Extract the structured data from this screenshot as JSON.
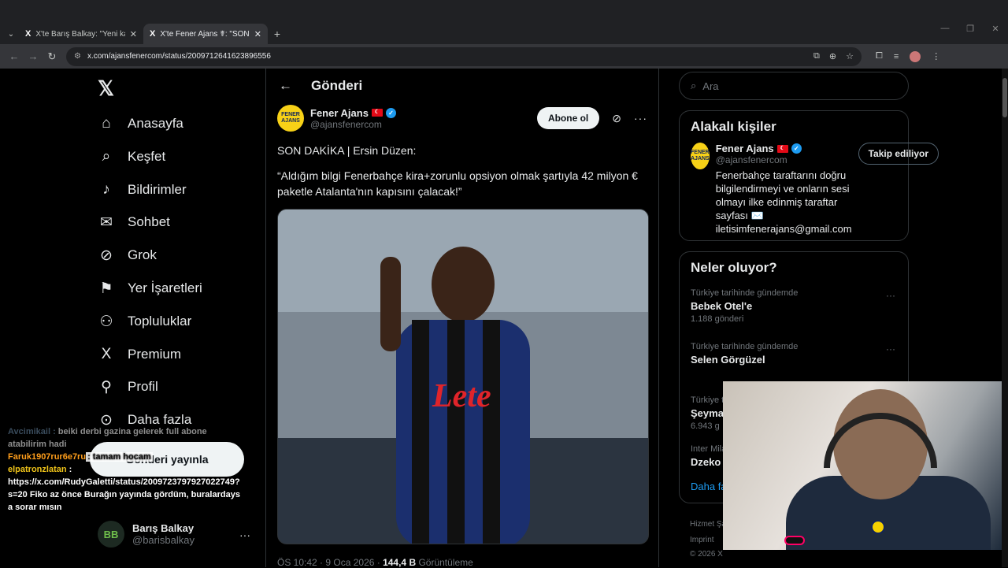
{
  "browser": {
    "tabs": [
      {
        "title": "X'te Barış Balkay: \"Yeni kamera",
        "favicon": "X"
      },
      {
        "title": "X'te Fener Ajans ☤: \"SON DAKİ",
        "favicon": "X"
      }
    ],
    "url": "x.com/ajansfenercom/status/2009712641623896556"
  },
  "nav": {
    "items": [
      {
        "label": "Anasayfa",
        "icon": "home-icon",
        "glyph": "⌂"
      },
      {
        "label": "Keşfet",
        "icon": "search-icon",
        "glyph": "⌕"
      },
      {
        "label": "Bildirimler",
        "icon": "bell-icon",
        "glyph": "🔔"
      },
      {
        "label": "Sohbet",
        "icon": "mail-icon",
        "glyph": "✉"
      },
      {
        "label": "Grok",
        "icon": "grok-icon",
        "glyph": "⊘"
      },
      {
        "label": "Yer İşaretleri",
        "icon": "bookmark-icon",
        "glyph": "⚑"
      },
      {
        "label": "Topluluklar",
        "icon": "communities-icon",
        "glyph": "⚇"
      },
      {
        "label": "Premium",
        "icon": "x-premium-icon",
        "glyph": "𝕏"
      },
      {
        "label": "Profil",
        "icon": "profile-icon",
        "glyph": "⚲"
      },
      {
        "label": "Daha fazla",
        "icon": "more-circle-icon",
        "glyph": "⊙"
      }
    ],
    "post_button": "Gönderi yayınla",
    "account": {
      "name": "Barış Balkay",
      "handle": "@barisbalkay",
      "avatar": "BB"
    }
  },
  "post": {
    "header": "Gönderi",
    "author": "Fener Ajans",
    "handle": "@ajansfenercom",
    "avatar_text": "FENER AJANS",
    "subscribe": "Abone ol",
    "line1": "SON DAKİKA | Ersin Düzen:",
    "line2": "“Aldığım bilgi Fenerbahçe kira+zorunlu opsiyon olmak şartıyla 42 milyon € paketle Atalanta'nın kapısını çalacak!”",
    "meta_time": "ÖS 10:42 · 9 Oca 2026 · ",
    "meta_views": "144,4 B",
    "meta_views_label": " Görüntüleme"
  },
  "right": {
    "search_placeholder": "Ara",
    "related_title": "Alakalı kişiler",
    "related": {
      "name": "Fener Ajans",
      "handle": "@ajansfenercom",
      "follow": "Takip ediliyor",
      "bio": "Fenerbahçe taraftarını doğru bilgilendirmeyi ve onların sesi olmayı ilke edinmiş taraftar sayfası ✉️ iletisimfenerajans@gmail.com"
    },
    "trends_title": "Neler oluyor?",
    "trends": [
      {
        "context": "Türkiye tarihinde gündemde",
        "name": "Bebek Otel'e",
        "count": "1.188 gönderi"
      },
      {
        "context": "Türkiye tarihinde gündemde",
        "name": "Selen Görgüzel",
        "count": ""
      },
      {
        "context": "Türkiye t",
        "name": "Şeyma",
        "count": "6.943 g"
      },
      {
        "context": "Inter Mila",
        "name": "Dzeko",
        "count": ""
      }
    ],
    "show_more": "Daha fa",
    "footer1": "Hizmet Şa",
    "footer2": "Imprint",
    "footer3": "© 2026 X"
  },
  "chat": {
    "line1_user": "Avcimikail :",
    "line1_text": " beiki derbi gazina gelerek full abone atabilirim hadi",
    "line2_user": "Faruk1907rur6e7ru",
    "line2_text": ": tamam hocam",
    "line3_user": "elpatronzlatan",
    "line3_text": " :",
    "line4_text": "https://x.com/RudyGaletti/status/2009723797927022749?s=20 Fiko az önce Burağın yayında gördüm, buralardaysa sorar mısın"
  }
}
